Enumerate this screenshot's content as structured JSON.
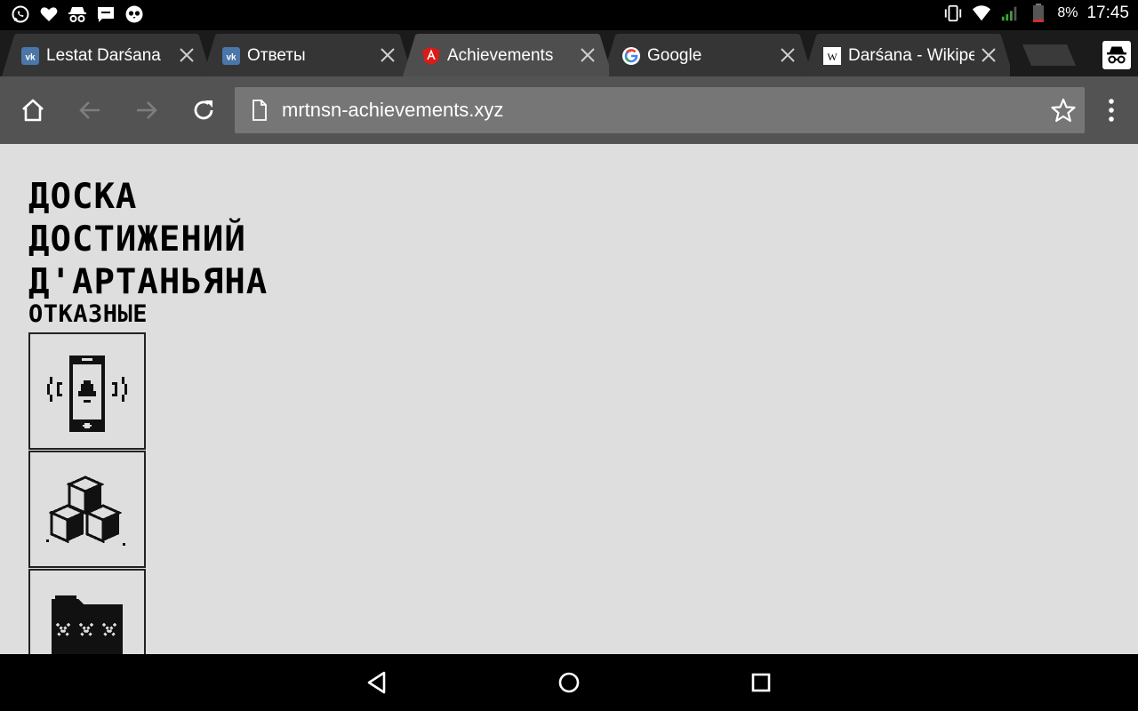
{
  "status_bar": {
    "notification_icons": [
      "whatsapp-icon",
      "vk-heart-icon",
      "incognito-icon",
      "message-icon",
      "owl-icon"
    ],
    "battery_percent": "8%",
    "time": "17:45"
  },
  "tabs": [
    {
      "title": "Lestat Darśana",
      "favicon": "vk-icon",
      "active": false
    },
    {
      "title": "Ответы",
      "favicon": "vk-icon",
      "active": false
    },
    {
      "title": "Achievements",
      "favicon": "angular-icon",
      "active": true
    },
    {
      "title": "Google",
      "favicon": "google-icon",
      "active": false
    },
    {
      "title": "Darśana - Wikipe",
      "favicon": "wikipedia-icon",
      "active": false
    }
  ],
  "toolbar": {
    "url": "mrtnsn-achievements.xyz"
  },
  "page": {
    "title": "Доска достижений Д'Артаньяна",
    "section": "Отказные",
    "achievements": [
      {
        "icon": "phone-bell-icon"
      },
      {
        "icon": "cubes-icon"
      },
      {
        "icon": "xxx-folder-icon"
      }
    ]
  },
  "colors": {
    "tab_active": "#4e4e4e",
    "tab_inactive": "#353535",
    "toolbar": "#535353",
    "omnibox": "#767676",
    "content_bg": "#dedede"
  }
}
